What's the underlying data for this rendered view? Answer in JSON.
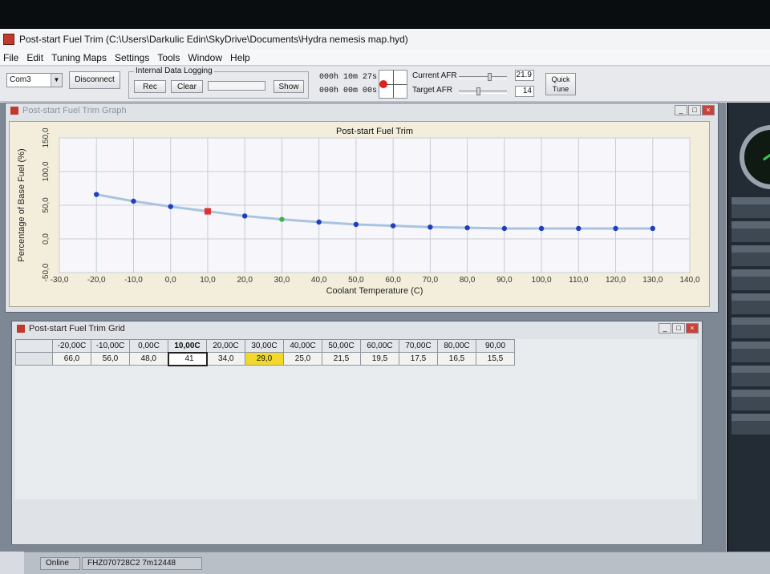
{
  "window": {
    "title": "Post-start Fuel Trim  (C:\\Users\\Darkulic Edin\\SkyDrive\\Documents\\Hydra nemesis map.hyd)"
  },
  "menu": [
    "File",
    "Edit",
    "Tuning Maps",
    "Settings",
    "Tools",
    "Window",
    "Help"
  ],
  "toolbar": {
    "port": "Com3",
    "disconnect_label": "Disconnect",
    "logging_group_label": "Internal Data Logging",
    "rec_label": "Rec",
    "clear_label": "Clear",
    "show_label": "Show",
    "timer1": "000h 10m 27s",
    "timer2": "000h 00m 00s",
    "current_afr_label": "Current AFR",
    "current_afr_value": "21.9",
    "target_afr_label": "Target AFR",
    "target_afr_value": "14",
    "quick_tune_label": "Quick Tune"
  },
  "graph_panel": {
    "title": "Post-start Fuel Trim Graph"
  },
  "chart_data": {
    "type": "line",
    "title": "Post-start Fuel Trim",
    "xlabel": "Coolant Temperature (C)",
    "ylabel": "Percentage of Base Fuel (%)",
    "xlim": [
      -30,
      140
    ],
    "ylim": [
      -50,
      150
    ],
    "x_ticks": [
      "-30,0",
      "-20,0",
      "-10,0",
      "0,0",
      "10,0",
      "20,0",
      "30,0",
      "40,0",
      "50,0",
      "60,0",
      "70,0",
      "80,0",
      "90,0",
      "100,0",
      "110,0",
      "120,0",
      "130,0",
      "140,0"
    ],
    "y_ticks": [
      "-50,0",
      "0,0",
      "50,0",
      "100,0",
      "150,0"
    ],
    "grid": true,
    "series": [
      {
        "x": [
          -20,
          -10,
          0,
          10,
          20,
          30,
          40,
          50,
          60,
          70,
          80,
          90,
          100,
          110,
          120,
          130
        ],
        "y": [
          66,
          56,
          48,
          41,
          34,
          29,
          25,
          21.5,
          19.5,
          17.5,
          16.5,
          15.5,
          15.5,
          15.5,
          15.5,
          15.5
        ]
      }
    ],
    "highlight": {
      "selected_index": 3,
      "selected_color": "#e03030",
      "current_index": 5,
      "current_color": "#3cb44b"
    },
    "point_color": "#1f3fbf",
    "line_color": "#a9c4e0"
  },
  "grid_panel": {
    "title": "Post-start Fuel Trim Grid",
    "headers": [
      "-20,00C",
      "-10,00C",
      "0,00C",
      "10,00C",
      "20,00C",
      "30,00C",
      "40,00C",
      "50,00C",
      "60,00C",
      "70,00C",
      "80,00C",
      "90,00"
    ],
    "values": [
      "66,0",
      "56,0",
      "48,0",
      "41",
      "34,0",
      "29,0",
      "25,0",
      "21,5",
      "19,5",
      "17,5",
      "16,5",
      "15,5"
    ]
  },
  "status": {
    "state": "Online",
    "serial": "FHZ070728C2 7m12448"
  }
}
